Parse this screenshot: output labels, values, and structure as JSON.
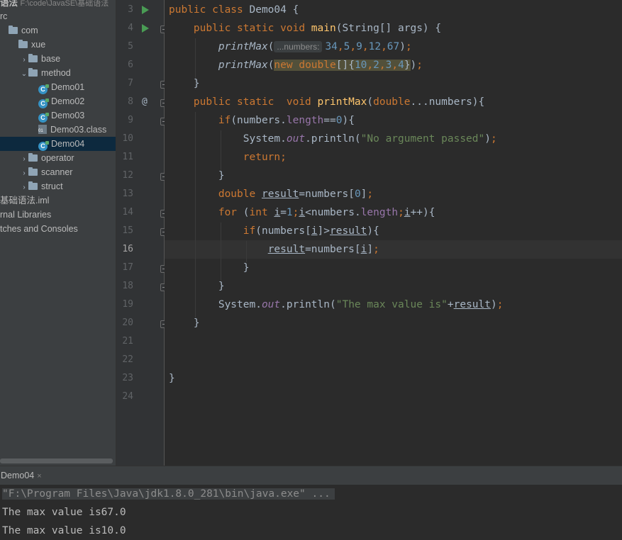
{
  "project": {
    "path_name": "语法",
    "path_location": "F:\\code\\JavaSE\\基础语法",
    "tree": [
      {
        "label": "rc",
        "kind": "text",
        "arrow": "",
        "indent": 0
      },
      {
        "label": "com",
        "kind": "folder",
        "arrow": "",
        "indent": 0
      },
      {
        "label": "xue",
        "kind": "folder",
        "arrow": "",
        "indent": 1
      },
      {
        "label": "base",
        "kind": "folder",
        "arrow": "›",
        "indent": 2
      },
      {
        "label": "method",
        "kind": "folder",
        "arrow": "⌄",
        "indent": 2
      },
      {
        "label": "Demo01",
        "kind": "class",
        "arrow": "",
        "indent": 3
      },
      {
        "label": "Demo02",
        "kind": "class",
        "arrow": "",
        "indent": 3
      },
      {
        "label": "Demo03",
        "kind": "class",
        "arrow": "",
        "indent": 3
      },
      {
        "label": "Demo03.class",
        "kind": "classfile",
        "arrow": "",
        "indent": 3
      },
      {
        "label": "Demo04",
        "kind": "class",
        "arrow": "",
        "indent": 3,
        "selected": true
      },
      {
        "label": "operator",
        "kind": "folder",
        "arrow": "›",
        "indent": 2
      },
      {
        "label": "scanner",
        "kind": "folder",
        "arrow": "›",
        "indent": 2
      },
      {
        "label": "struct",
        "kind": "folder",
        "arrow": "›",
        "indent": 2
      },
      {
        "label": "基础语法.iml",
        "kind": "text",
        "arrow": "",
        "indent": 0
      },
      {
        "label": "rnal Libraries",
        "kind": "text",
        "arrow": "",
        "indent": 0
      },
      {
        "label": "tches and Consoles",
        "kind": "text",
        "arrow": "",
        "indent": 0
      }
    ]
  },
  "editor": {
    "line_numbers": [
      "3",
      "4",
      "5",
      "6",
      "7",
      "8",
      "9",
      "10",
      "11",
      "12",
      "13",
      "14",
      "15",
      "16",
      "17",
      "18",
      "19",
      "20",
      "21",
      "22",
      "23",
      "24"
    ],
    "current_line": "16",
    "param_hint": "...numbers:",
    "strings": {
      "no_arg": "\"No argument passed\"",
      "max_value": "\"The max value is\""
    }
  },
  "run": {
    "tab_label": "Demo04",
    "close_glyph": "×",
    "command": "\"F:\\Program Files\\Java\\jdk1.8.0_281\\bin\\java.exe\" ...",
    "output": [
      "The max value is67.0",
      "The max value is10.0"
    ]
  },
  "colors": {
    "keyword": "#cc7832",
    "method": "#ffc66d",
    "number": "#6897bb",
    "string": "#6a8759",
    "field": "#9876aa",
    "selection": "#0d293e"
  }
}
